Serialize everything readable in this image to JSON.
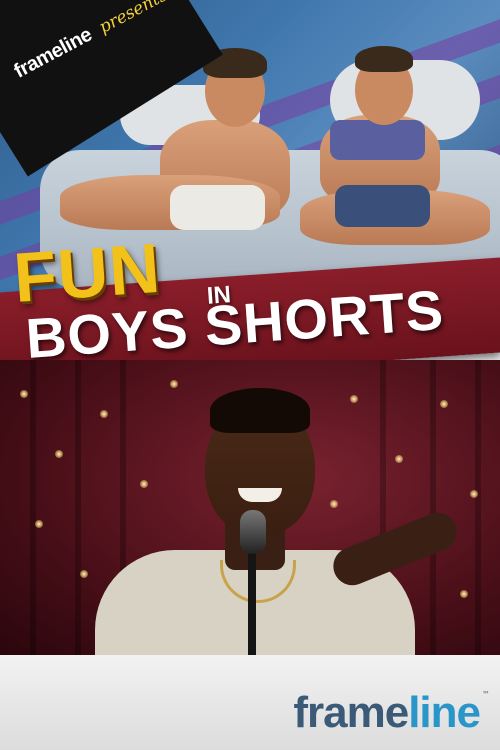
{
  "poster": {
    "top_logo": "frameline",
    "top_presents": "presents",
    "title_fun": "FUN",
    "title_in": "IN",
    "title_boys_shorts": "BOYS SHORTS",
    "footer_logo_part1": "frame",
    "footer_logo_part2": "line",
    "footer_logo_tm": "™"
  },
  "colors": {
    "title_yellow": "#f2c21a",
    "title_band_red": "#8a1e2a",
    "logo_dark_blue": "#3a5a78",
    "logo_light_blue": "#2a95c9",
    "presents_yellow": "#f4d13b"
  }
}
